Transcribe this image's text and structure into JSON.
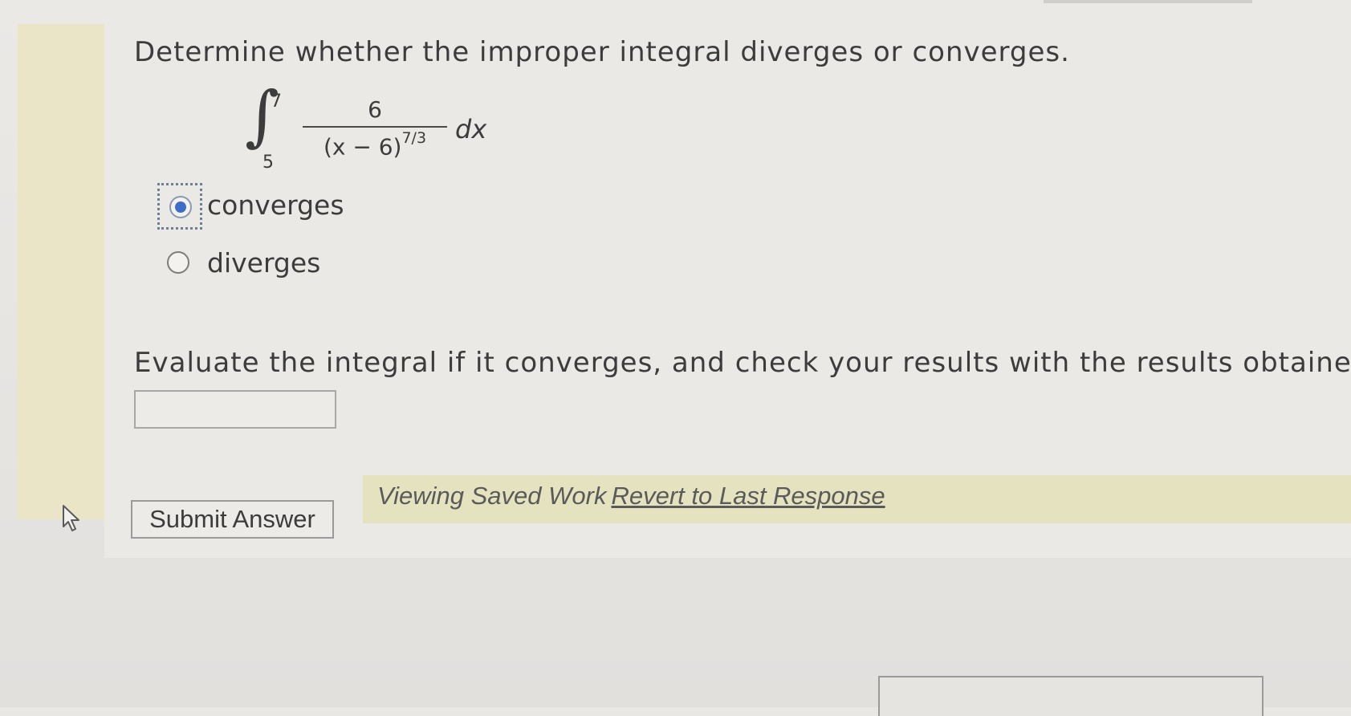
{
  "question": {
    "prompt": "Determine whether the improper integral diverges or converges."
  },
  "integral": {
    "sign": "∫",
    "upper_limit": "7",
    "lower_limit": "5",
    "numerator": "6",
    "denominator_base": "(x − 6)",
    "denominator_exponent": "7/3",
    "differential": "dx"
  },
  "options": [
    {
      "label": "converges",
      "selected": true
    },
    {
      "label": "diverges",
      "selected": false
    }
  ],
  "evaluate": {
    "prompt": "Evaluate the integral if it converges, and check your results with the results obtained by",
    "answer_value": ""
  },
  "actions": {
    "submit_label": "Submit Answer"
  },
  "status": {
    "saved_text": "Viewing Saved Work",
    "revert_label": "Revert to Last Response"
  },
  "colors": {
    "accent": "#3f6ec8",
    "banner": "#e5e3bf"
  },
  "icons": {
    "cursor": "mouse-pointer-icon"
  }
}
